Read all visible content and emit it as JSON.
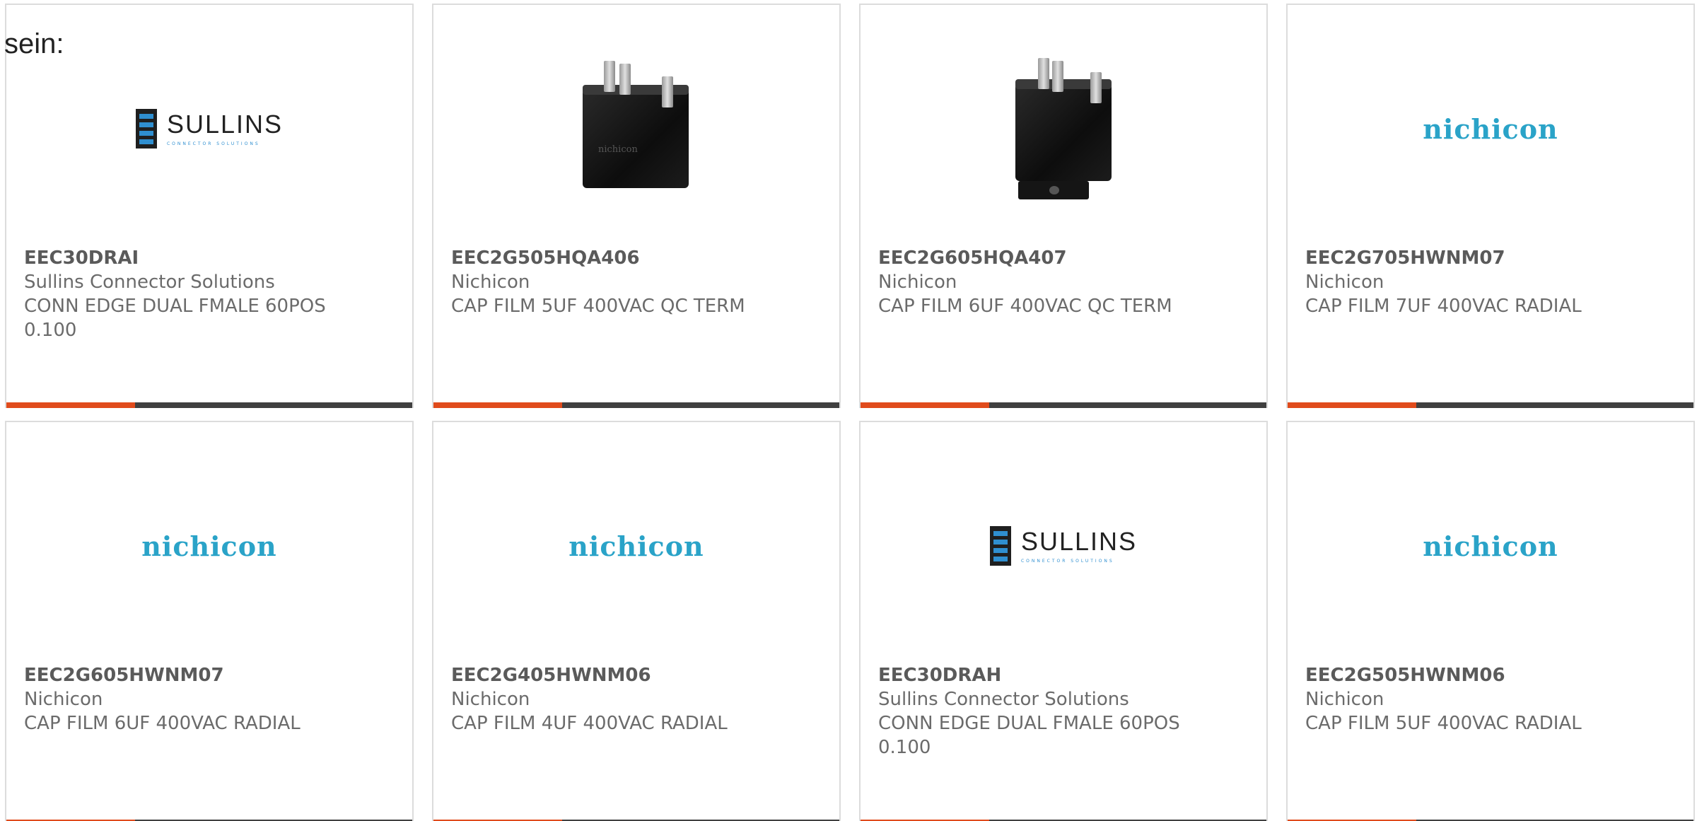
{
  "intro_text": "sein:",
  "accent_color": "#e04b1c",
  "bar_color": "#404040",
  "logo_color_nichicon": "#2aa3c8",
  "products": [
    {
      "image": "sullins-logo",
      "logo_text": "SULLINS",
      "logo_tagline": "CONNECTOR SOLUTIONS",
      "part_number": "EEC30DRAI",
      "manufacturer": "Sullins Connector Solutions",
      "description": "CONN EDGE DUAL FMALE 60POS 0.100"
    },
    {
      "image": "capacitor-photo",
      "logo_text": "nichicon",
      "part_number": "EEC2G505HQA406",
      "manufacturer": "Nichicon",
      "description": "CAP FILM 5UF 400VAC QC TERM"
    },
    {
      "image": "capacitor-photo-with-bracket",
      "logo_text": "",
      "part_number": "EEC2G605HQA407",
      "manufacturer": "Nichicon",
      "description": "CAP FILM 6UF 400VAC QC TERM"
    },
    {
      "image": "nichicon-logo",
      "logo_text": "nichicon",
      "part_number": "EEC2G705HWNM07",
      "manufacturer": "Nichicon",
      "description": "CAP FILM 7UF 400VAC RADIAL"
    },
    {
      "image": "nichicon-logo",
      "logo_text": "nichicon",
      "part_number": "EEC2G605HWNM07",
      "manufacturer": "Nichicon",
      "description": "CAP FILM 6UF 400VAC RADIAL"
    },
    {
      "image": "nichicon-logo",
      "logo_text": "nichicon",
      "part_number": "EEC2G405HWNM06",
      "manufacturer": "Nichicon",
      "description": "CAP FILM 4UF 400VAC RADIAL"
    },
    {
      "image": "sullins-logo",
      "logo_text": "SULLINS",
      "logo_tagline": "CONNECTOR SOLUTIONS",
      "part_number": "EEC30DRAH",
      "manufacturer": "Sullins Connector Solutions",
      "description": "CONN EDGE DUAL FMALE 60POS 0.100"
    },
    {
      "image": "nichicon-logo",
      "logo_text": "nichicon",
      "part_number": "EEC2G505HWNM06",
      "manufacturer": "Nichicon",
      "description": "CAP FILM 5UF 400VAC RADIAL"
    }
  ]
}
